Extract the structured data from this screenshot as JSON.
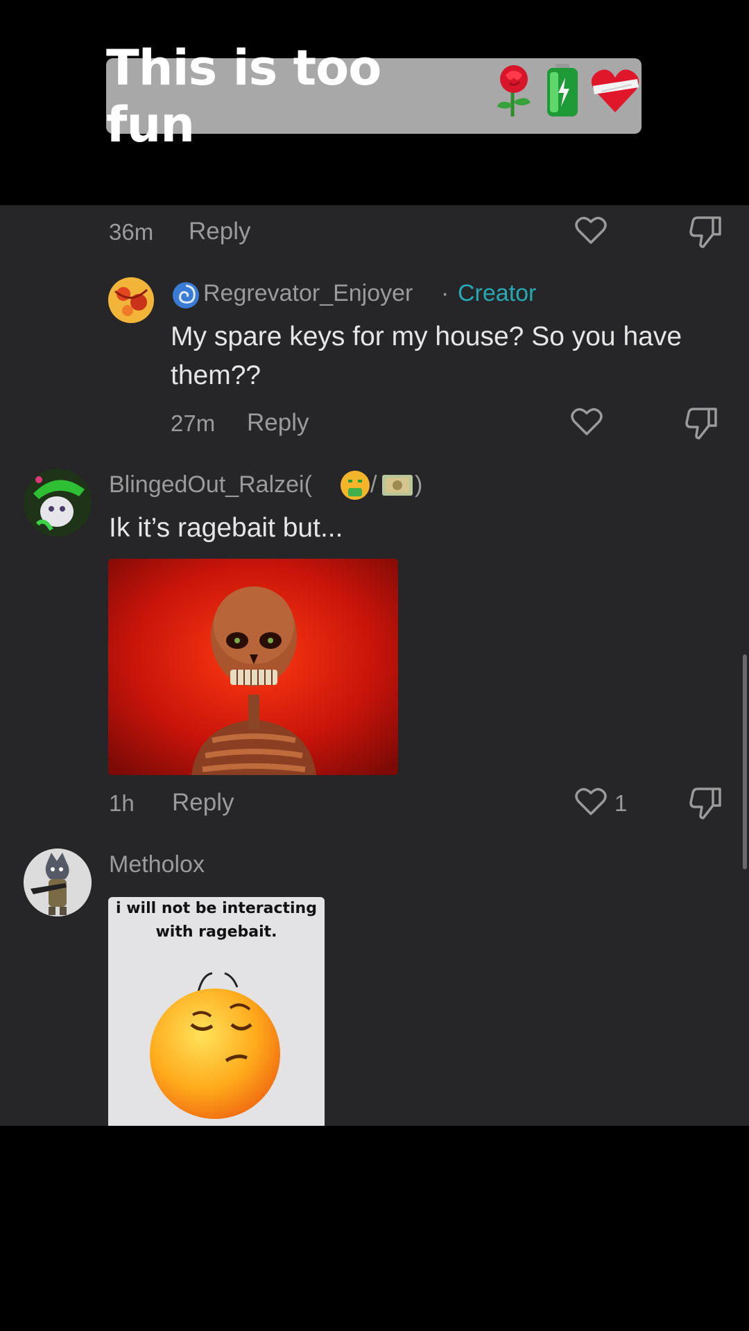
{
  "caption": {
    "text": "This is too fun",
    "emojis": [
      "rose-emoji",
      "battery-emoji",
      "bandaged-heart-emoji"
    ]
  },
  "comments": [
    {
      "time": "36m",
      "reply_label": "Reply"
    },
    {
      "username": "Regrevator_Enjoyer",
      "username_prefix_icon": "cyclone-emoji",
      "separator": "·",
      "badge": "Creator",
      "text": "My spare keys for my house? So you have them??",
      "time": "27m",
      "reply_label": "Reply"
    },
    {
      "username": "BlingedOut_Ralzei(",
      "username_emojis": [
        "money-mouth-emoji",
        "dollar-banknote-emoji"
      ],
      "username_mid": "/",
      "username_end": ")",
      "text": "Ik it’s ragebait but...",
      "time": "1h",
      "reply_label": "Reply",
      "likes": "1",
      "media": "red-skeleton-image"
    },
    {
      "username": "Metholox",
      "media_caption": "i will not be interacting with ragebait.",
      "media": "unamused-emoji-image"
    }
  ],
  "colors": {
    "panel": "#262628",
    "accent": "#25a9b4",
    "caption_bg": "#a8a8a8"
  }
}
